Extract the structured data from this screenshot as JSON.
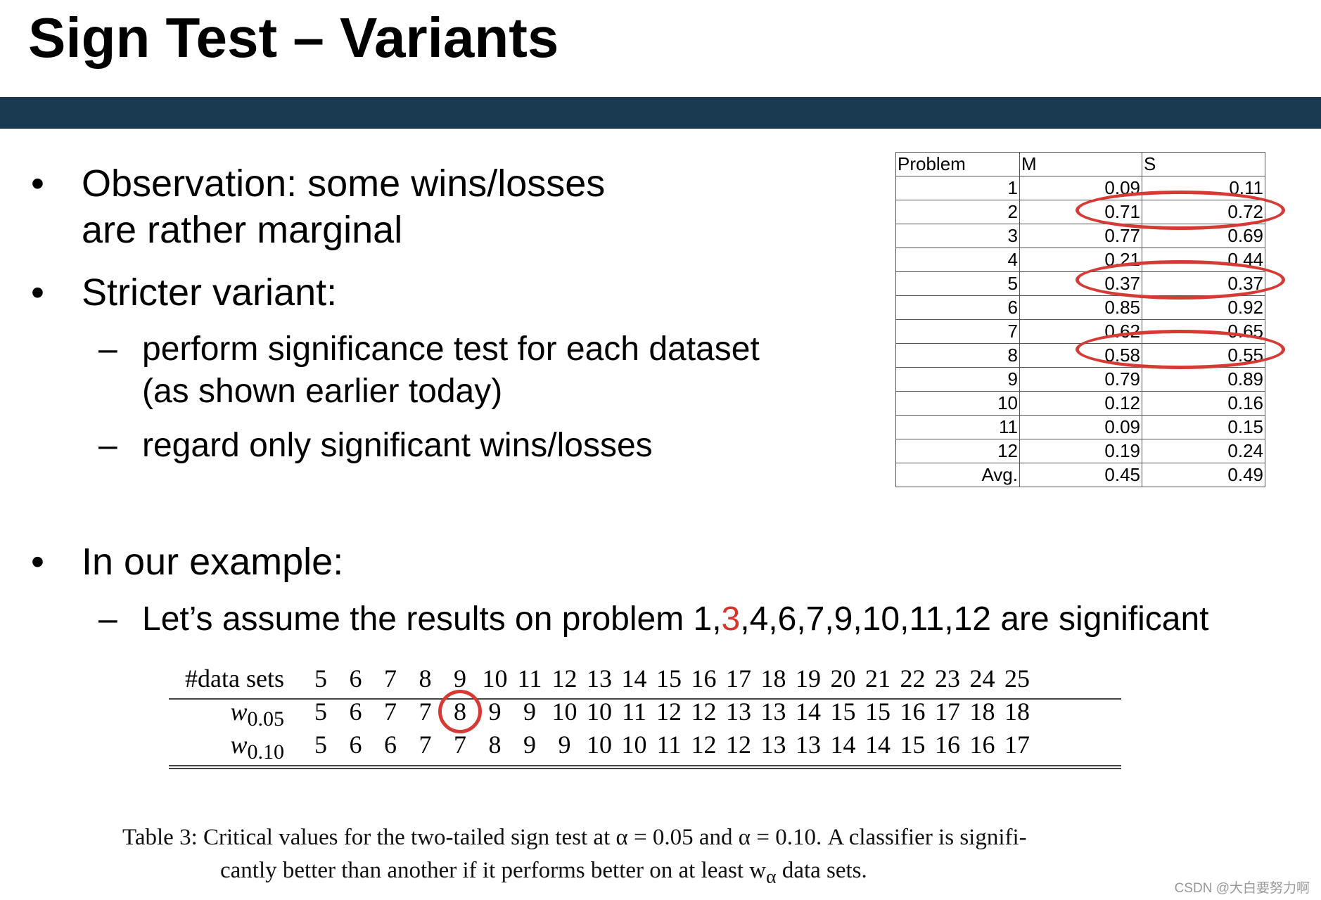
{
  "title": "Sign Test – Variants",
  "colors": {
    "band": "#1a3a52",
    "highlight": "#d63a34"
  },
  "bullets": [
    {
      "lines": [
        "Observation: some wins/losses",
        "are rather marginal"
      ]
    },
    {
      "text": "Stricter variant:",
      "subs": [
        {
          "lines": [
            "perform significance test for each dataset",
            "(as shown earlier today)"
          ]
        },
        {
          "lines": [
            "regard only significant wins/losses"
          ]
        }
      ]
    },
    {
      "text": "In our example:",
      "subs": [
        {
          "prefix": "Let’s assume the results on problem 1,",
          "highlight": "3",
          "suffix": ",4,6,7,9,10,11,12 are significant"
        }
      ]
    }
  ],
  "bullet_symbol": "•",
  "dash_symbol": "–",
  "problem_table": {
    "headers": [
      "Problem",
      "M",
      "S"
    ],
    "rows": [
      [
        "1",
        "0.09",
        "0.11"
      ],
      [
        "2",
        "0.71",
        "0.72"
      ],
      [
        "3",
        "0.77",
        "0.69"
      ],
      [
        "4",
        "0.21",
        "0.44"
      ],
      [
        "5",
        "0.37",
        "0.37"
      ],
      [
        "6",
        "0.85",
        "0.92"
      ],
      [
        "7",
        "0.62",
        "0.65"
      ],
      [
        "8",
        "0.58",
        "0.55"
      ],
      [
        "9",
        "0.79",
        "0.89"
      ],
      [
        "10",
        "0.12",
        "0.16"
      ],
      [
        "11",
        "0.09",
        "0.15"
      ],
      [
        "12",
        "0.19",
        "0.24"
      ],
      [
        "Avg.",
        "0.45",
        "0.49"
      ]
    ],
    "circled_problems": [
      "2",
      "5",
      "8"
    ]
  },
  "critical_table": {
    "header_label": "#data sets",
    "datasets": [
      "5",
      "6",
      "7",
      "8",
      "9",
      "10",
      "11",
      "12",
      "13",
      "14",
      "15",
      "16",
      "17",
      "18",
      "19",
      "20",
      "21",
      "22",
      "23",
      "24",
      "25"
    ],
    "rows": [
      {
        "label": "w",
        "sub": "0.05",
        "values": [
          "5",
          "6",
          "7",
          "7",
          "8",
          "9",
          "9",
          "10",
          "10",
          "11",
          "12",
          "12",
          "13",
          "13",
          "14",
          "15",
          "15",
          "16",
          "17",
          "18",
          "18"
        ]
      },
      {
        "label": "w",
        "sub": "0.10",
        "values": [
          "5",
          "6",
          "6",
          "7",
          "7",
          "8",
          "9",
          "9",
          "10",
          "10",
          "11",
          "12",
          "12",
          "13",
          "13",
          "14",
          "14",
          "15",
          "16",
          "16",
          "17"
        ]
      }
    ],
    "circled": {
      "row": 0,
      "col": 4
    }
  },
  "caption": {
    "line1": "Table 3:  Critical values for the two-tailed sign test at α = 0.05 and α = 0.10. A classifier is signifi-",
    "line2": "cantly better than another if it performs better on at least w",
    "line2_sub": "α",
    "line2_end": " data sets."
  },
  "watermark": "CSDN @大白要努力啊"
}
